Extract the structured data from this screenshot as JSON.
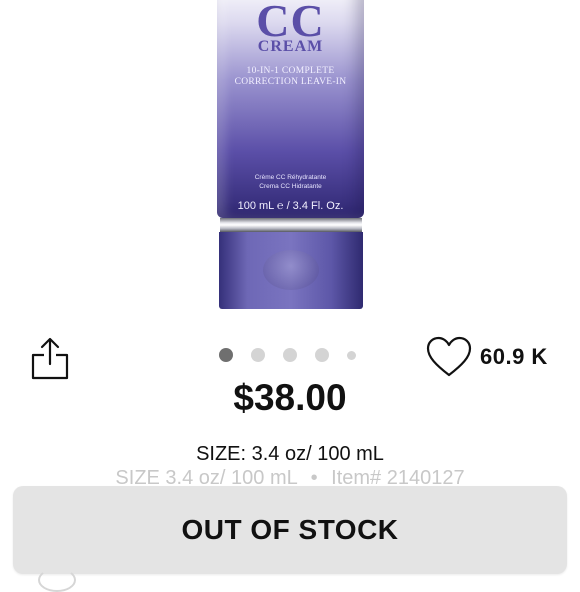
{
  "product": {
    "brand_line1": "CC",
    "brand_line2": "CREAM",
    "tagline_line1": "10-IN-1 COMPLETE",
    "tagline_line2": "CORRECTION LEAVE-IN",
    "name_fr": "Crème CC Réhydratante",
    "name_es": "Crema CC Hidratante",
    "volume": "100 mL ℮ / 3.4 Fl. Oz.",
    "tube_color": "#5b4fa8"
  },
  "carousel": {
    "total": 5,
    "active_index": 0
  },
  "share": {
    "icon": "share-icon"
  },
  "likes": {
    "icon": "heart-icon",
    "count": "60.9 K"
  },
  "price": "$38.00",
  "size": {
    "primary": "SIZE: 3.4 oz/ 100 mL",
    "secondary_size": "SIZE 3.4 oz/ 100 mL",
    "separator": "•",
    "item_number": "Item# 2140127"
  },
  "stock_button": {
    "label": "OUT OF STOCK",
    "bg": "#e4e4e4"
  },
  "colors": {
    "accent": "#5b4fa8",
    "text": "#111111",
    "muted": "#c8c8c8"
  }
}
